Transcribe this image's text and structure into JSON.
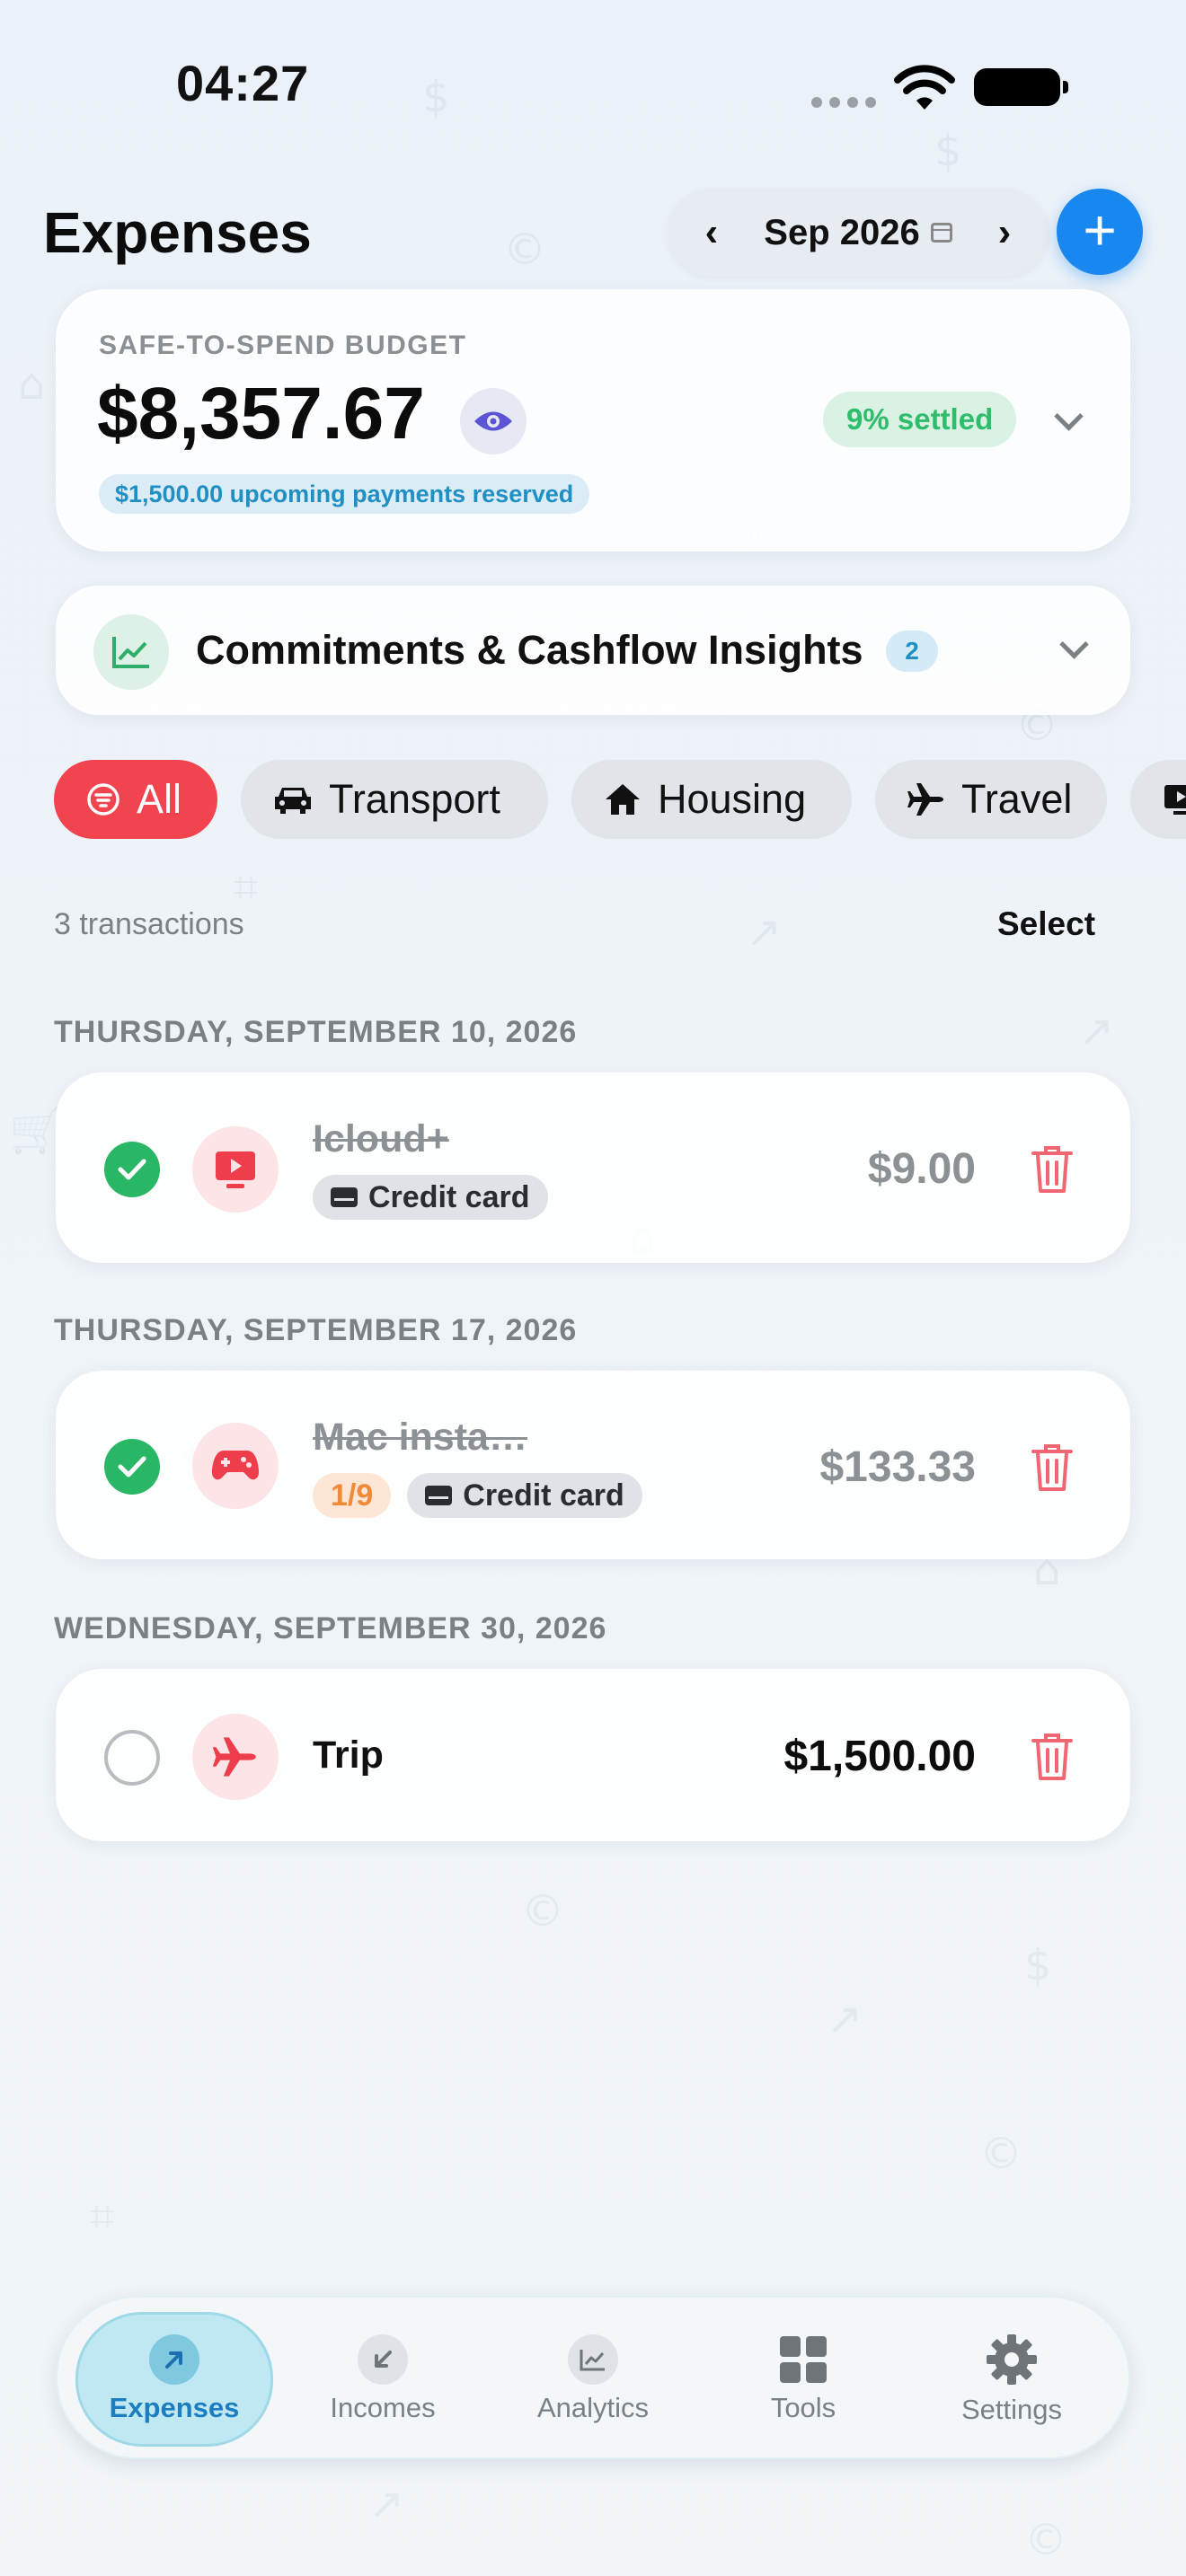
{
  "status_bar": {
    "time": "04:27"
  },
  "header": {
    "title": "Expenses",
    "month": "Sep 2026",
    "add_label": "+"
  },
  "budget": {
    "label": "SAFE-TO-SPEND BUDGET",
    "amount": "$8,357.67",
    "reserved": "$1,500.00 upcoming payments reserved",
    "settled": "9% settled",
    "settled_fraction": 0.09
  },
  "insights": {
    "title": "Commitments & Cashflow Insights",
    "badge": "2"
  },
  "filters": [
    {
      "label": "All",
      "icon": "filter-icon",
      "active": true
    },
    {
      "label": "Transport",
      "icon": "car-icon",
      "active": false
    },
    {
      "label": "Housing",
      "icon": "house-icon",
      "active": false
    },
    {
      "label": "Travel",
      "icon": "airplane-icon",
      "active": false
    }
  ],
  "list": {
    "count_label": "3 transactions",
    "select_label": "Select"
  },
  "groups": [
    {
      "date": "THURSDAY, SEPTEMBER 10, 2026",
      "transaction": {
        "name": "Icloud+",
        "category_icon": "tv-play-icon",
        "installment": "",
        "payment": "Credit card",
        "amount": "$9.00",
        "settled": true
      }
    },
    {
      "date": "THURSDAY, SEPTEMBER 17, 2026",
      "transaction": {
        "name": "Mac insta…",
        "category_icon": "gamepad-icon",
        "installment": "1/9",
        "payment": "Credit card",
        "amount": "$133.33",
        "settled": true
      }
    },
    {
      "date": "WEDNESDAY, SEPTEMBER 30, 2026",
      "transaction": {
        "name": "Trip",
        "category_icon": "airplane-icon",
        "installment": "",
        "payment": "",
        "amount": "$1,500.00",
        "settled": false
      }
    }
  ],
  "tab_bar": {
    "tabs": [
      {
        "label": "Expenses",
        "icon": "arrow-up-right-icon",
        "active": true
      },
      {
        "label": "Incomes",
        "icon": "arrow-down-left-icon",
        "active": false
      },
      {
        "label": "Analytics",
        "icon": "chart-icon",
        "active": false
      },
      {
        "label": "Tools",
        "icon": "grid-icon",
        "active": false
      },
      {
        "label": "Settings",
        "icon": "gear-icon",
        "active": false
      }
    ]
  },
  "colors": {
    "accent_blue": "#1888f0",
    "danger_red": "#f2444f",
    "success_green": "#29b765",
    "info_blue": "#1f8fc4"
  }
}
